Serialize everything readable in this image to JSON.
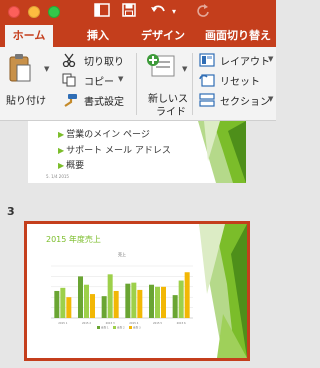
{
  "tabs": [
    {
      "label": "ホーム",
      "active": true
    },
    {
      "label": "挿入",
      "active": false
    },
    {
      "label": "デザイン",
      "active": false
    },
    {
      "label": "画面切り替え",
      "active": false
    }
  ],
  "ribbon": {
    "paste_label": "貼り付け",
    "cut_label": "切り取り",
    "copy_label": "コピー",
    "format_label": "書式設定",
    "new_slide_line1": "新しいス",
    "new_slide_line2": "ライド",
    "layout_label": "レイアウト",
    "reset_label": "リセット",
    "section_label": "セクション"
  },
  "slide2": {
    "bullets": [
      "営業のメイン ページ",
      "サポート メール アドレス",
      "概要"
    ],
    "footer": "5. 1/4 2015"
  },
  "slide3": {
    "number": "3",
    "title": "2015 年度売上",
    "chart_data": {
      "type": "bar",
      "title": "売上",
      "categories": [
        "2015 1",
        "2015 2",
        "2015 3",
        "2015 4",
        "2015 5",
        "2015 6"
      ],
      "series": [
        {
          "name": "系列 1",
          "color": "#6aa533",
          "values": [
            2.6,
            4.0,
            2.1,
            3.3,
            3.2,
            2.2
          ]
        },
        {
          "name": "系列 2",
          "color": "#9dd04a",
          "values": [
            2.9,
            3.2,
            4.2,
            3.4,
            3.0,
            3.6
          ]
        },
        {
          "name": "系列 3",
          "color": "#f2b705",
          "values": [
            2.0,
            2.3,
            2.6,
            2.7,
            3.0,
            4.4
          ]
        }
      ],
      "ylim": [
        0,
        5
      ]
    }
  },
  "colors": {
    "accent": "#c43e1c",
    "selection": "#c43e1c",
    "green": "#7bbd2a"
  }
}
